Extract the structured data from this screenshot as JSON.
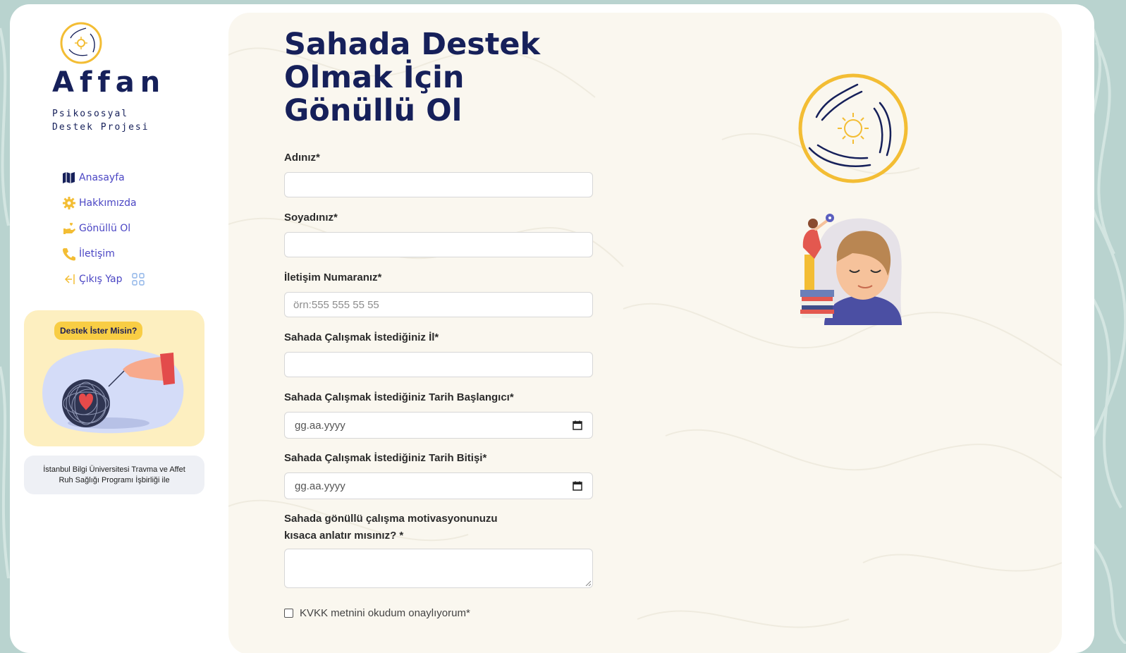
{
  "brand": {
    "name": "Affan",
    "subtitle_line1": "Psikososyal",
    "subtitle_line2": "Destek Projesi"
  },
  "nav": {
    "items": [
      {
        "label": "Anasayfa",
        "icon": "map-icon"
      },
      {
        "label": "Hakkımızda",
        "icon": "gear-icon"
      },
      {
        "label": "Gönüllü Ol",
        "icon": "hand-heart-icon"
      },
      {
        "label": "İletişim",
        "icon": "phone-icon"
      },
      {
        "label": "Çıkış Yap",
        "icon": "logout-icon"
      }
    ]
  },
  "support_card": {
    "badge": "Destek İster Misin?"
  },
  "credit": {
    "text": "İstanbul Bilgi Üniversitesi Travma ve Affet Ruh Sağlığı Programı İşbirliği ile"
  },
  "page": {
    "title_line1": "Sahada Destek",
    "title_line2": "Olmak İçin",
    "title_line3": "Gönüllü Ol"
  },
  "form": {
    "first_name": {
      "label": "Adınız*",
      "value": "",
      "placeholder": ""
    },
    "last_name": {
      "label": "Soyadınız*",
      "value": "",
      "placeholder": ""
    },
    "phone": {
      "label": "İletişim Numaranız*",
      "value": "",
      "placeholder": "örn:555 555 55 55"
    },
    "city": {
      "label": "Sahada Çalışmak İstediğiniz İl*",
      "value": "",
      "placeholder": ""
    },
    "start_date": {
      "label": "Sahada Çalışmak İstediğiniz Tarih Başlangıcı*",
      "value": "gg.aa.yyyy"
    },
    "end_date": {
      "label": "Sahada Çalışmak İstediğiniz Tarih Bitişi*",
      "value": "gg.aa.yyyy"
    },
    "motivation": {
      "label_line1": "Sahada gönüllü çalışma motivasyonunuzu",
      "label_line2": "kısaca anlatır mısınız? *",
      "value": ""
    },
    "kvkk": {
      "label": "KVKK metnini okudum onaylıyorum*",
      "checked": false
    }
  },
  "colors": {
    "brand_navy": "#16205a",
    "brand_yellow": "#f3bd34",
    "nav_text": "#4b46c4",
    "panel_bg": "#faf7ef",
    "outer_bg": "#b9d3cf"
  }
}
